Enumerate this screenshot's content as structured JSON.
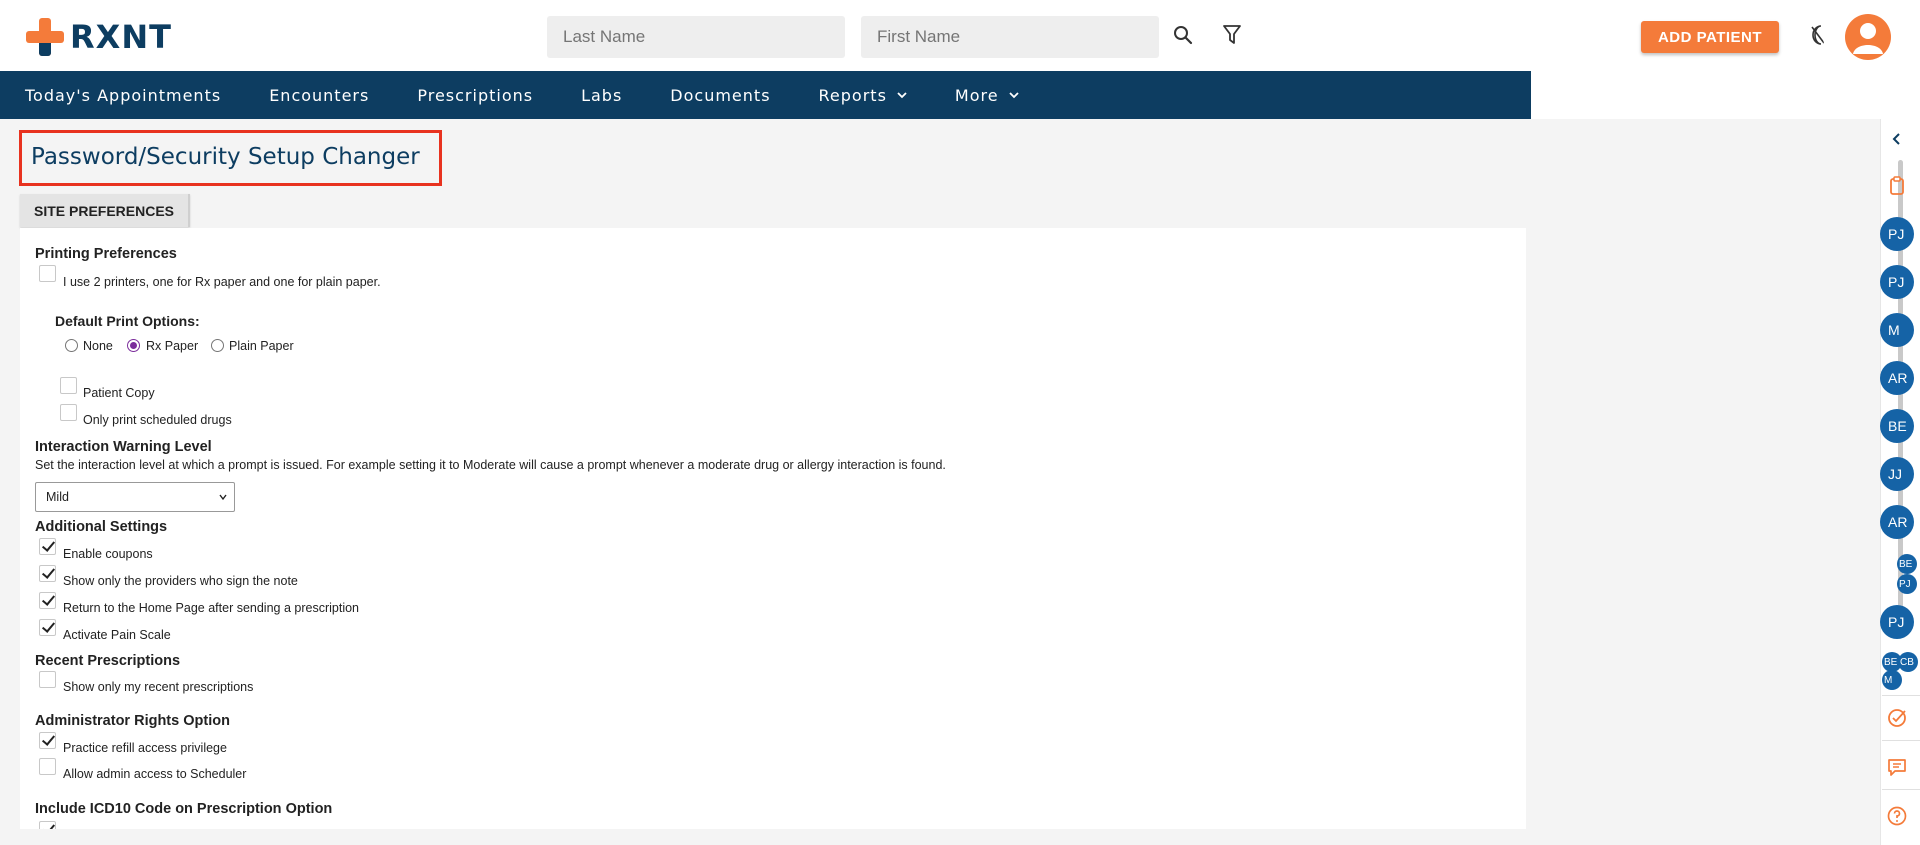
{
  "header": {
    "logo_text": "RXNT",
    "last_name_placeholder": "Last Name",
    "first_name_placeholder": "First Name",
    "add_patient_label": "ADD PATIENT"
  },
  "nav": {
    "items": [
      {
        "label": "Today's Appointments"
      },
      {
        "label": "Encounters"
      },
      {
        "label": "Prescriptions"
      },
      {
        "label": "Labs"
      },
      {
        "label": "Documents"
      },
      {
        "label": "Reports"
      },
      {
        "label": "More"
      }
    ]
  },
  "page": {
    "title": "Password/Security Setup Changer",
    "tab_label": "SITE PREFERENCES"
  },
  "printing": {
    "heading": "Printing Preferences",
    "two_printers_label": "I use 2 printers, one for Rx paper and one for plain paper.",
    "two_printers_checked": false,
    "default_options_heading": "Default Print Options:",
    "options": [
      "None",
      "Rx Paper",
      "Plain Paper"
    ],
    "selected_option": "Rx Paper",
    "patient_copy_label": "Patient Copy",
    "scheduled_only_label": "Only print scheduled drugs"
  },
  "interaction": {
    "heading": "Interaction Warning Level",
    "description": "Set the interaction level at which a prompt is issued. For example setting it to Moderate will cause a prompt whenever a moderate drug or allergy interaction is found.",
    "selected_level": "Mild"
  },
  "additional": {
    "heading": "Additional Settings",
    "items": [
      {
        "label": "Enable coupons",
        "checked": true
      },
      {
        "label": "Show only the providers who sign the note",
        "checked": true
      },
      {
        "label": "Return to the Home Page after sending a prescription",
        "checked": true
      },
      {
        "label": "Activate Pain Scale",
        "checked": true
      }
    ]
  },
  "recent": {
    "heading": "Recent Prescriptions",
    "label": "Show only my recent prescriptions",
    "checked": false
  },
  "admin": {
    "heading": "Administrator Rights Option",
    "items": [
      {
        "label": "Practice refill access privilege",
        "checked": true
      },
      {
        "label": "Allow admin access to Scheduler",
        "checked": false
      }
    ]
  },
  "icd10": {
    "heading": "Include ICD10 Code on Prescription Option"
  },
  "rail": {
    "bubbles": [
      "PJ",
      "PJ",
      "M",
      "AR",
      "BE",
      "JJ",
      "AR",
      "PJ"
    ],
    "small_bubbles": [
      "BE",
      "PJ",
      "BE",
      "CB",
      "M"
    ]
  },
  "colors": {
    "navy": "#0d3d61",
    "orange": "#f47b3a",
    "highlight_red": "#e8321f",
    "bubble_blue": "#1563a6"
  }
}
